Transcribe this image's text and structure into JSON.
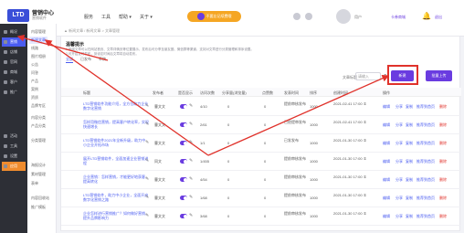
{
  "topbar": {
    "logo": "LTD",
    "title": "营销中心",
    "subtitle": "营销软件",
    "nav": [
      "服务",
      "工具",
      "帮助 ▾",
      "关于 ▾"
    ],
    "pill": "不要忘记续费哦",
    "user": "用户",
    "link": "卡券商城",
    "link2": "退出"
  },
  "sidebar_dark": {
    "items": [
      {
        "label": "概况"
      },
      {
        "label": "营销"
      },
      {
        "label": "店铺"
      },
      {
        "label": "官网"
      },
      {
        "label": "商城"
      },
      {
        "label": "客户"
      },
      {
        "label": "推广"
      },
      {
        "label": "活动"
      },
      {
        "label": "工具"
      },
      {
        "label": "设置"
      },
      {
        "label": "应用"
      }
    ]
  },
  "sidebar_sub": {
    "items": [
      {
        "label": "内容管理"
      },
      {
        "label": "新闻文章"
      },
      {
        "label": "线路"
      },
      {
        "label": "图片相册"
      },
      {
        "label": "公告"
      },
      {
        "label": "问答"
      },
      {
        "label": "产品"
      },
      {
        "label": "案例"
      },
      {
        "label": "资质"
      },
      {
        "label": "品牌专区"
      },
      {
        "label": "内容分类"
      },
      {
        "label": "产品分类"
      },
      {
        "label": "分类管理"
      },
      {
        "label": "海报设计"
      },
      {
        "label": "素材管理"
      },
      {
        "label": "表单"
      },
      {
        "label": "内容回收站"
      },
      {
        "label": "推广模板"
      }
    ]
  },
  "breadcrumb": "▲ 新闻文章 / 新闻文章 > 文章管理",
  "alert": {
    "title": "温馨提示",
    "line1": "1.新闻文章可以在网站首页、文章详情页等位置展示，发布后可分享至朋友圈、微信群等渠道，支持对文章进行分类管理和排序设置。",
    "line2": "2.可开启定时发布，到设定时间后文章将自动发布。"
  },
  "tabs": [
    "全部",
    "已发布",
    "草稿"
  ],
  "toolbar": {
    "search_label": "文章标题",
    "search_placeholder": "请输入",
    "new_label": "新建",
    "add_label": "批量上传"
  },
  "table": {
    "headers": [
      "标题",
      "发布者",
      "是否显示",
      "访问次数",
      "分享量(浏览量)",
      "点赞数",
      "发表时间",
      "排序",
      "创建时间",
      "操作"
    ],
    "rows": [
      {
        "title": "LTD营销软件功能介绍，全方位助力企业数字化营销",
        "author": "曹文文",
        "views": "4/10",
        "shares": "0",
        "likes": "0",
        "status": "提前审核发布",
        "sort": "1000",
        "date": "2021-02-41 17:00 ①",
        "actions": [
          "编辑",
          "分享",
          "复制",
          "推荐到首页",
          "删除"
        ]
      },
      {
        "title": "怎样用微信营销，提高客户转化率，实现快速增长",
        "author": "曹文文",
        "views": "2/61",
        "shares": "0",
        "likes": "0",
        "status": "已经提审发布",
        "sort": "1000",
        "date": "2021-02-41 17:00 ①",
        "actions": [
          "编辑",
          "分享",
          "复制",
          "推荐到首页",
          "删除"
        ]
      },
      {
        "title": "LTD营销软件2021年全新升级，助力中小企业开拓市场",
        "author": "曹文文",
        "views": "1/1",
        "shares": "0",
        "likes": "0",
        "status": "已发发布",
        "sort": "1000",
        "date": "2021-01-30 17:00 ②",
        "actions": [
          "编辑",
          "分享",
          "复制",
          "推荐到首页",
          "删除"
        ]
      },
      {
        "title": "展开LTD营销软件，全面加速企业营销进程",
        "author": "同文",
        "views": "1/455",
        "shares": "0",
        "likes": "0",
        "status": "提前审核发布",
        "sort": "1000",
        "date": "2021-01-30 17:00 ①",
        "actions": [
          "编辑",
          "分享",
          "复制",
          "推荐到首页",
          "删除"
        ]
      },
      {
        "title": "企业营销：怎样营销，才能更好地获客，提高转化",
        "author": "曹文文",
        "views": "4/54",
        "shares": "0",
        "likes": "0",
        "status": "提前审核发布",
        "sort": "1000",
        "date": "2021-01-30 17:00 ①",
        "actions": [
          "编辑",
          "分享",
          "复制",
          "推荐到首页",
          "删除"
        ]
      },
      {
        "title": "LTD营销软件，助力中小企业，全面开启数字化营销之路",
        "author": "曹文文",
        "views": "1/68",
        "shares": "0",
        "likes": "0",
        "status": "提前审核发布",
        "sort": "1000",
        "date": "2021-01-30 17:00 ①",
        "actions": [
          "编辑",
          "分享",
          "复制",
          "推荐到首页",
          "删除"
        ]
      },
      {
        "title": "企业怎样进行营销推广？如何做好营销，提升品牌影响力",
        "author": "曹文文",
        "views": "3/68",
        "shares": "0",
        "likes": "0",
        "status": "提前审核发布",
        "sort": "1000",
        "date": "2021-01-30 17:00 ①",
        "actions": [
          "编辑",
          "分享",
          "复制",
          "推荐到首页",
          "删除"
        ]
      }
    ]
  },
  "colors": {
    "accent": "#6a3ce0",
    "link": "#4a5cf0",
    "highlight": "#e0322b",
    "sidebar": "#2d2f36"
  }
}
